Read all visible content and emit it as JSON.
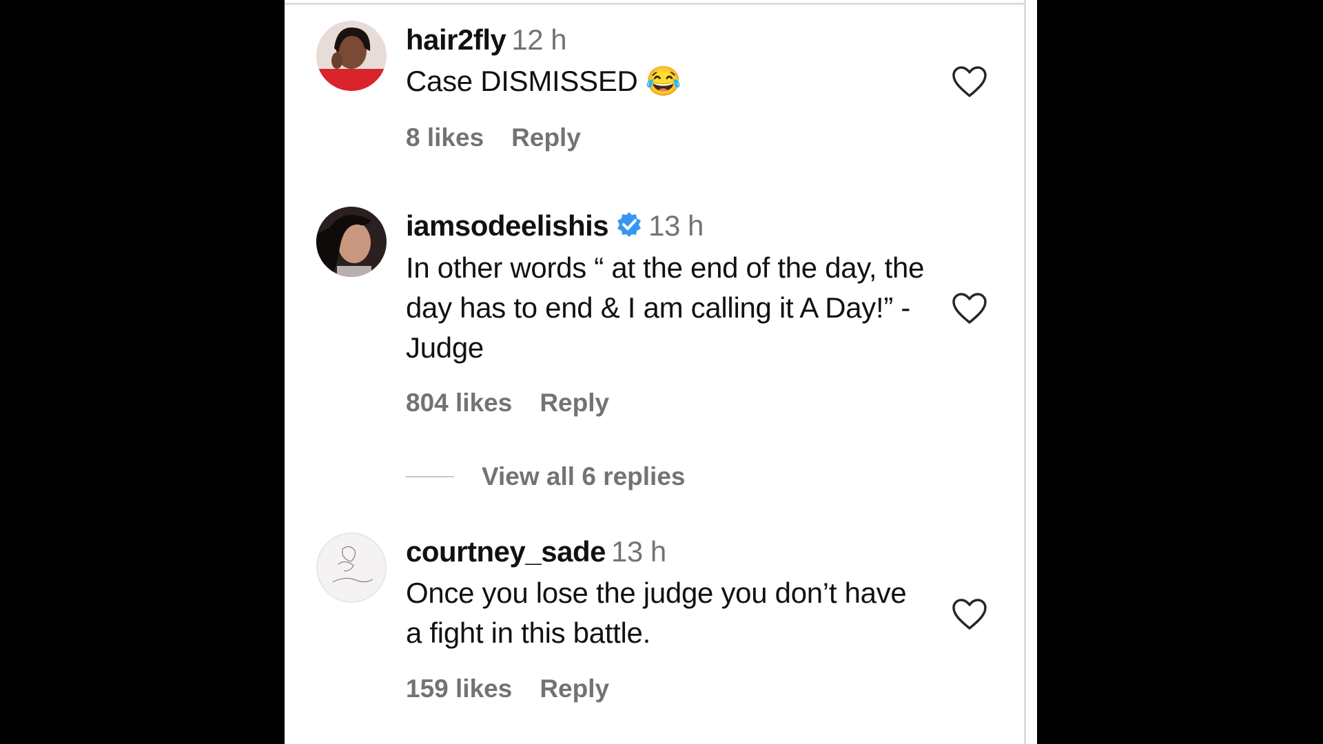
{
  "comments": [
    {
      "username": "hair2fly",
      "time": "12 h",
      "text": "Case DISMISSED 😂",
      "likes": "8 likes",
      "reply": "Reply",
      "avatar": "user-avatar-photo"
    },
    {
      "username": "iamsodeelishis",
      "verified": true,
      "time": "13 h",
      "text": "In other words “ at the end of the day, the day has to end & I am calling it A Day!” -Judge",
      "likes": "804 likes",
      "reply": "Reply",
      "view_replies": "View all 6 replies",
      "avatar": "user-avatar-photo"
    },
    {
      "username": "courtney_sade",
      "time": "13 h",
      "text": "Once you lose the judge you don’t have a fight in this battle.",
      "likes": "159 likes",
      "reply": "Reply",
      "avatar": "user-avatar-sketch-logo"
    }
  ],
  "colors": {
    "text": "#111111",
    "secondary": "#737373",
    "verified": "#3797f0",
    "background": "#ffffff"
  },
  "icons": [
    "heart-icon",
    "verified-badge-icon"
  ]
}
